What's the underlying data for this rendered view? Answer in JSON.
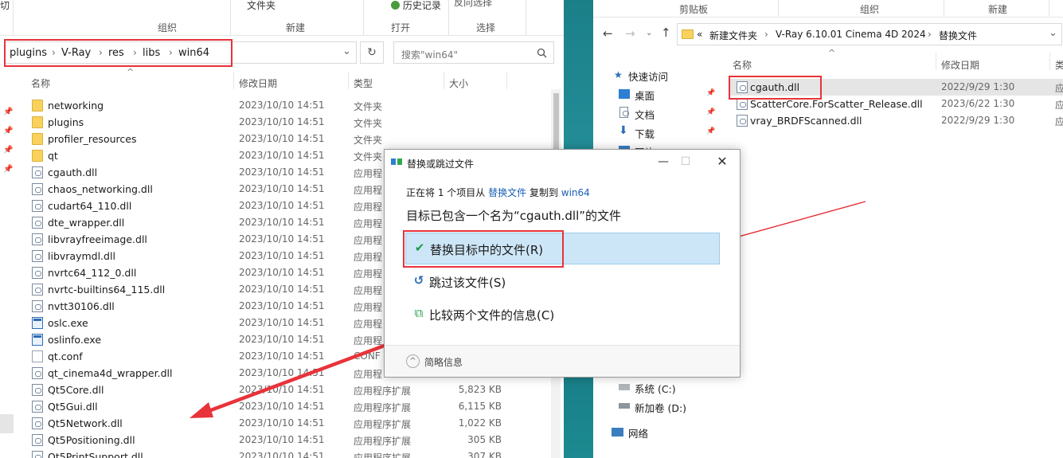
{
  "left": {
    "ribbon_top": {
      "pin_fragment": "切",
      "file_folder": "文件夹",
      "history": "历史记录",
      "select_fragment": "反向选择"
    },
    "ribbon_groups": {
      "organize": "组织",
      "new": "新建",
      "open": "打开",
      "select": "选择"
    },
    "breadcrumb": [
      "plugins",
      "V-Ray",
      "res",
      "libs",
      "win64"
    ],
    "search_placeholder": "搜索\"win64\"",
    "columns": {
      "name": "名称",
      "date": "修改日期",
      "type": "类型",
      "size": "大小"
    },
    "files": [
      {
        "name": "networking",
        "date": "2023/10/10 14:51",
        "type": "文件夹",
        "size": "",
        "kind": "folder"
      },
      {
        "name": "plugins",
        "date": "2023/10/10 14:51",
        "type": "文件夹",
        "size": "",
        "kind": "folder"
      },
      {
        "name": "profiler_resources",
        "date": "2023/10/10 14:51",
        "type": "文件夹",
        "size": "",
        "kind": "folder"
      },
      {
        "name": "qt",
        "date": "2023/10/10 14:51",
        "type": "文件夹",
        "size": "",
        "kind": "folder"
      },
      {
        "name": "cgauth.dll",
        "date": "2023/10/10 14:51",
        "type": "应用程",
        "size": "",
        "kind": "dll"
      },
      {
        "name": "chaos_networking.dll",
        "date": "2023/10/10 14:51",
        "type": "应用程",
        "size": "",
        "kind": "dll"
      },
      {
        "name": "cudart64_110.dll",
        "date": "2023/10/10 14:51",
        "type": "应用程",
        "size": "",
        "kind": "dll"
      },
      {
        "name": "dte_wrapper.dll",
        "date": "2023/10/10 14:51",
        "type": "应用程",
        "size": "",
        "kind": "dll"
      },
      {
        "name": "libvrayfreeimage.dll",
        "date": "2023/10/10 14:51",
        "type": "应用程",
        "size": "",
        "kind": "dll"
      },
      {
        "name": "libvraymdl.dll",
        "date": "2023/10/10 14:51",
        "type": "应用程",
        "size": "",
        "kind": "dll"
      },
      {
        "name": "nvrtc64_112_0.dll",
        "date": "2023/10/10 14:51",
        "type": "应用程",
        "size": "",
        "kind": "dll"
      },
      {
        "name": "nvrtc-builtins64_115.dll",
        "date": "2023/10/10 14:51",
        "type": "应用程",
        "size": "",
        "kind": "dll"
      },
      {
        "name": "nvtt30106.dll",
        "date": "2023/10/10 14:51",
        "type": "应用程",
        "size": "",
        "kind": "dll"
      },
      {
        "name": "oslc.exe",
        "date": "2023/10/10 14:51",
        "type": "应用程",
        "size": "",
        "kind": "exe"
      },
      {
        "name": "oslinfo.exe",
        "date": "2023/10/10 14:51",
        "type": "应用程",
        "size": "",
        "kind": "exe"
      },
      {
        "name": "qt.conf",
        "date": "2023/10/10 14:51",
        "type": "CONF",
        "size": "",
        "kind": "conf"
      },
      {
        "name": "qt_cinema4d_wrapper.dll",
        "date": "2023/10/10 14:51",
        "type": "应用程",
        "size": "",
        "kind": "dll"
      },
      {
        "name": "Qt5Core.dll",
        "date": "2023/10/10 14:51",
        "type": "应用程序扩展",
        "size": "5,823 KB",
        "kind": "dll"
      },
      {
        "name": "Qt5Gui.dll",
        "date": "2023/10/10 14:51",
        "type": "应用程序扩展",
        "size": "6,115 KB",
        "kind": "dll"
      },
      {
        "name": "Qt5Network.dll",
        "date": "2023/10/10 14:51",
        "type": "应用程序扩展",
        "size": "1,022 KB",
        "kind": "dll"
      },
      {
        "name": "Qt5Positioning.dll",
        "date": "2023/10/10 14:51",
        "type": "应用程序扩展",
        "size": "305 KB",
        "kind": "dll"
      },
      {
        "name": "Qt5PrintSupport.dll",
        "date": "2023/10/10 14:51",
        "type": "应用程序扩展",
        "size": "307 KB",
        "kind": "dll"
      }
    ]
  },
  "right": {
    "ribbon_groups": {
      "clipboard": "剪贴板",
      "organize": "组织",
      "new": "新建"
    },
    "breadcrumb_prefix": "«",
    "breadcrumb": [
      "新建文件夹",
      "V-Ray 6.10.01 Cinema 4D 2024",
      "替换文件"
    ],
    "columns": {
      "name": "名称",
      "date": "修改日期",
      "type": "类"
    },
    "nav": {
      "quick_access": "快速访问",
      "desktop": "桌面",
      "documents": "文档",
      "downloads": "下载",
      "pictures": "图片",
      "system_c": "系统 (C:)",
      "new_volume_d": "新加卷 (D:)",
      "network": "网络"
    },
    "files": [
      {
        "name": "cgauth.dll",
        "date": "2022/9/29 1:30",
        "type": "应"
      },
      {
        "name": "ScatterCore.ForScatter_Release.dll",
        "date": "2023/6/22 1:30",
        "type": "应"
      },
      {
        "name": "vray_BRDFScanned.dll",
        "date": "2022/9/29 1:30",
        "type": "应"
      }
    ]
  },
  "dialog": {
    "title": "替换或跳过文件",
    "line1_a": "正在将 1 个项目从",
    "line1_src": "替换文件",
    "line1_b": "复制到",
    "line1_dst": "win64",
    "heading": "目标已包含一个名为“cgauth.dll”的文件",
    "option_replace": "替换目标中的文件(R)",
    "option_skip": "跳过该文件(S)",
    "option_compare": "比较两个文件的信息(C)",
    "footer": "简略信息"
  },
  "colors": {
    "highlight_red": "#e8333a",
    "selected_option_bg": "#cde6f7",
    "link_blue": "#1a5fb4",
    "teal_strip": "#1f8a92"
  }
}
